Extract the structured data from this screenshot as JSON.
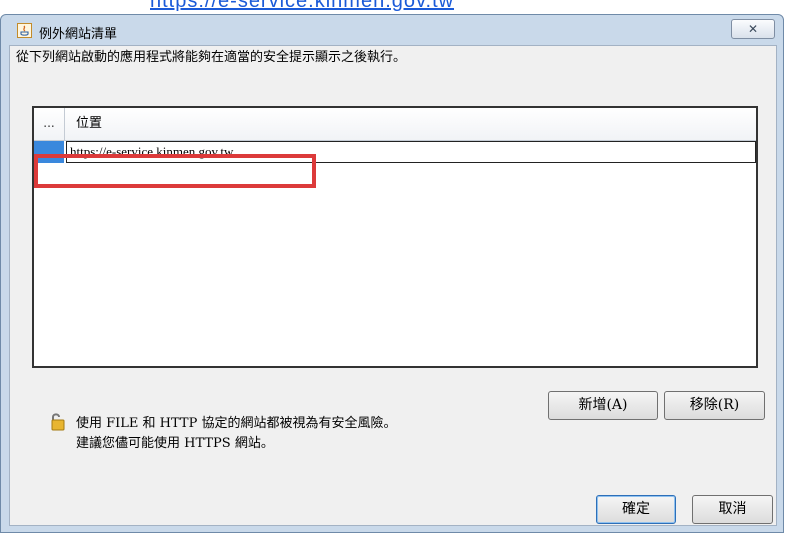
{
  "background_link": {
    "text": "https://e-service.kinmen.gov.tw"
  },
  "window": {
    "title": "例外網站清單",
    "close_symbol": "✕",
    "icon": "java-icon"
  },
  "dialog": {
    "description": "從下列網站啟動的應用程式將能夠在適當的安全提示顯示之後執行。",
    "table": {
      "index_header": "...",
      "location_header": "位置",
      "rows": [
        {
          "location": "https://e-service.kinmen.gov.tw"
        }
      ]
    },
    "buttons": {
      "add": "新增(A)",
      "remove": "移除(R)",
      "ok": "確定",
      "cancel": "取消"
    },
    "warning": {
      "icon": "open-lock-icon",
      "line1": "使用 FILE 和 HTTP 協定的網站都被視為有安全風險。",
      "line2": "建議您儘可能使用 HTTPS 網站。"
    }
  },
  "colors": {
    "selection": "#3a88dd",
    "highlight": "#dc3a3a",
    "frame": "#c9d9ea"
  }
}
